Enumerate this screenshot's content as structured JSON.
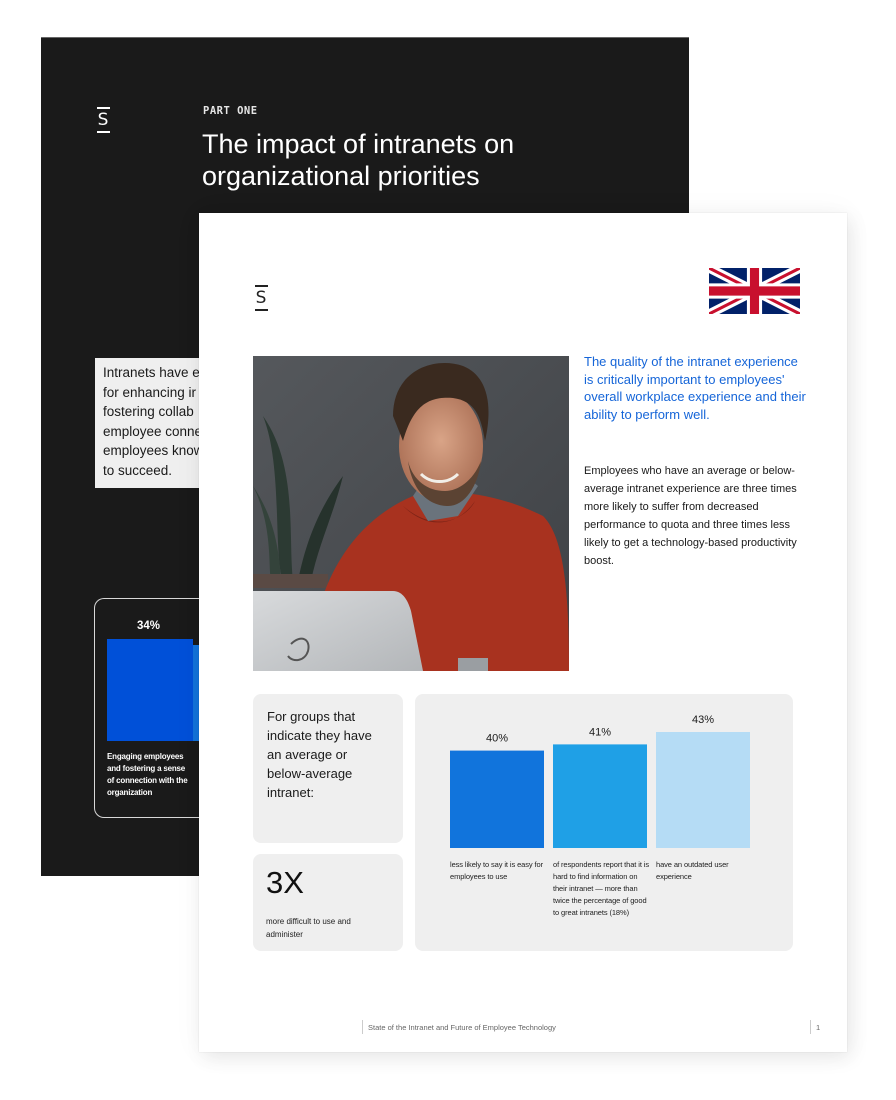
{
  "back_page": {
    "logo": "S",
    "section_label": "PART ONE",
    "title": "The impact of intranets on organizational priorities",
    "intro_lines": [
      "Intranets have e",
      "for enhancing ir",
      "fostering collab",
      "employee conne",
      "employees know",
      "to succeed."
    ],
    "chart": {
      "bar_label": "34%",
      "bar_caption": "Engaging employees and fostering a sense of connection with the organization",
      "colors": [
        "#0050d8",
        "#1373db"
      ]
    }
  },
  "front_page": {
    "logo": "S",
    "flag": "united-kingdom-flag",
    "lead_text": "The quality of the intranet experience is critically important to employees' overall workplace experience and their ability to perform well.",
    "body_text": "Employees who have an average or below-average intranet experience are three times more likely to suffer from decreased performance to quota and three times less likely to get a technology-based productivity boost.",
    "groups_card_text": "For groups that indicate they have an average or below-average intranet:",
    "stat": {
      "value": "3X",
      "caption": "more difficult to use and administer"
    },
    "footer": {
      "title": "State of the Intranet and Future of Employee Technology",
      "page_number": "1"
    },
    "accent_color": "#1565d8"
  },
  "chart_data": {
    "type": "bar",
    "title": "",
    "xlabel": "",
    "ylabel": "",
    "categories": [
      "less likely to say it is easy for employees to use",
      "of respondents report that it is hard to find information on their intranet — more than twice the percentage of good to great intranets (18%)",
      "have an outdated user experience"
    ],
    "values": [
      40,
      41,
      43
    ],
    "labels": [
      "40%",
      "41%",
      "43%"
    ],
    "colors": [
      "#1174dc",
      "#1fa0e6",
      "#b5dcf5"
    ],
    "ylim": [
      0,
      43
    ],
    "grid": false,
    "legend": "none"
  }
}
